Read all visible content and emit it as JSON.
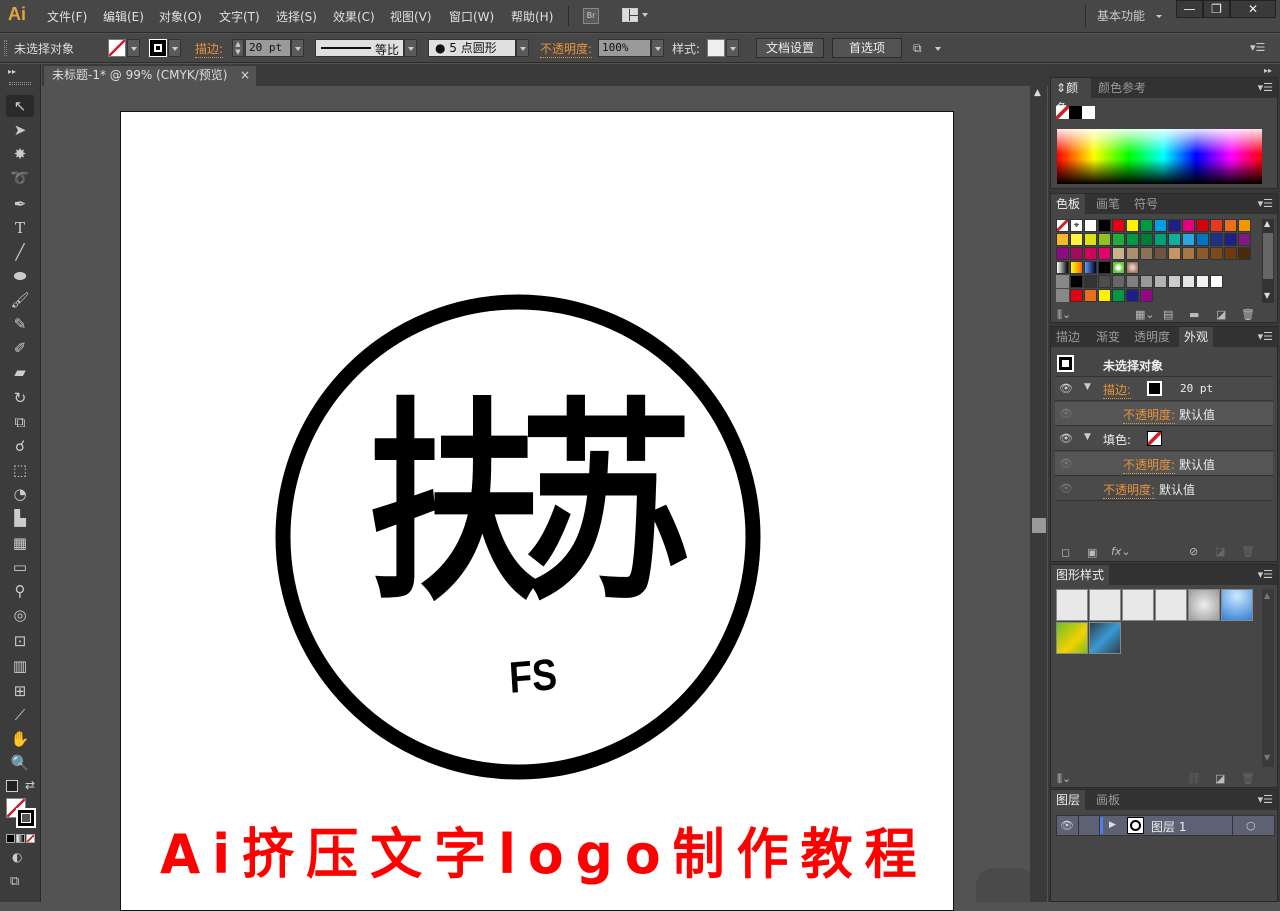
{
  "app": {
    "logo": "Ai",
    "workspace": "基本功能"
  },
  "menu": [
    "文件(F)",
    "编辑(E)",
    "对象(O)",
    "文字(T)",
    "选择(S)",
    "效果(C)",
    "视图(V)",
    "窗口(W)",
    "帮助(H)"
  ],
  "menu_icons": {
    "bridge": "Br",
    "arrange": "arrange-documents-icon"
  },
  "window_controls": {
    "minimize": "—",
    "restore": "❐",
    "close": "✕"
  },
  "control_bar": {
    "selection": "未选择对象",
    "stroke_label": "描边:",
    "stroke_weight": "20 pt",
    "stroke_profile": "等比",
    "brush": "5 点圆形",
    "opacity_label": "不透明度:",
    "opacity_value": "100%",
    "style_label": "样式:",
    "doc_setup": "文档设置",
    "preferences": "首选项"
  },
  "document_tab": {
    "title": "未标题-1* @ 99% (CMYK/预览)",
    "close": "×"
  },
  "tools": [
    "selection",
    "direct-selection",
    "magic-wand",
    "lasso",
    "pen",
    "type",
    "line-segment",
    "ellipse",
    "paintbrush",
    "pencil",
    "blob-brush",
    "eraser",
    "rotate",
    "scale",
    "warp",
    "free-transform",
    "shape-builder",
    "perspective-grid",
    "mesh",
    "gradient",
    "eyedropper",
    "blend",
    "symbol-sprayer",
    "column-graph",
    "artboard",
    "slice",
    "hand",
    "zoom"
  ],
  "artwork": {
    "logo_chars": "扶苏",
    "logo_sub": "FS",
    "caption": "Ai挤压文字logo制作教程",
    "caption_color": "#ff0000"
  },
  "panels": {
    "color": {
      "tabs": [
        "颜色",
        "颜色参考"
      ]
    },
    "swatches": {
      "tabs": [
        "色板",
        "画笔",
        "符号"
      ],
      "rows": [
        [
          "none",
          "reg",
          "#ffffff",
          "#000000",
          "#e60012",
          "#fff100",
          "#009944",
          "#00a0e9",
          "#1d2088",
          "#e4007f",
          "#d7000f",
          "#e83820",
          "#ec6d1b",
          "#f39800"
        ],
        [
          "#f8b62d",
          "#fff33f",
          "#dde30f",
          "#8fc31f",
          "#22ac38",
          "#009a44",
          "#007c3d",
          "#00a179",
          "#13ae9e",
          "#2ca6e0",
          "#0075c1",
          "#1d2f87",
          "#1d2088",
          "#7d1b7e"
        ],
        [
          "#920783",
          "#a40b5d",
          "#d7005f",
          "#e5006a",
          "#c9b28e",
          "#a8906c",
          "#8b735a",
          "#6d5442",
          "#c49664",
          "#a57845",
          "#8a5b2a",
          "#7b4a1f",
          "#6b3a10",
          "#4d2a0c"
        ],
        [
          "grad-bw",
          "grad-orange",
          "grad-blue",
          "#000000",
          "pattern-green",
          "pattern-brown"
        ],
        [
          "folder",
          "#000000",
          "#333333",
          "#4d4d4d",
          "#666666",
          "#808080",
          "#999999",
          "#b3b3b3",
          "#cccccc",
          "#e6e6e6",
          "#f2f2f2",
          "#ffffff"
        ],
        [
          "folder",
          "#e60012",
          "#ec6d1b",
          "#fff100",
          "#009944",
          "#1d2088",
          "#920783"
        ]
      ]
    },
    "appearance": {
      "tabs": [
        "描边",
        "渐变",
        "透明度",
        "外观"
      ],
      "header": "未选择对象",
      "stroke_label": "描边:",
      "stroke_value": "20 pt",
      "opacity_label": "不透明度:",
      "opacity_value": "默认值",
      "fill_label": "填色:"
    },
    "graphic_styles": {
      "tabs": [
        "图形样式"
      ]
    },
    "layers": {
      "tabs": [
        "图层",
        "画板"
      ],
      "layer_name": "图层 1"
    }
  }
}
